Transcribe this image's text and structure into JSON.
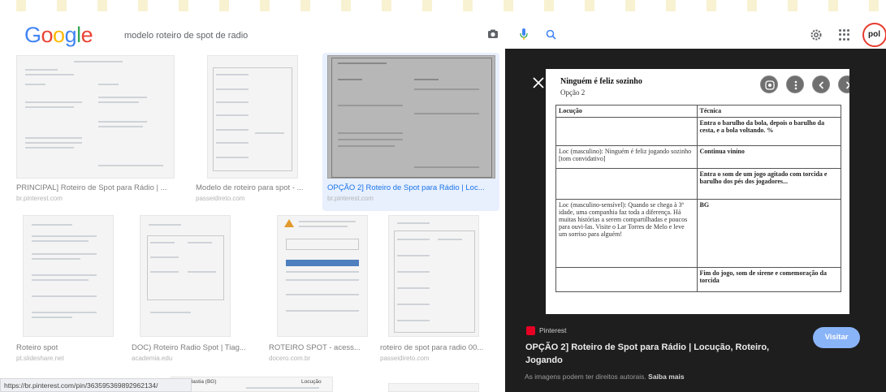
{
  "search": {
    "query": "modelo roteiro de spot de radio"
  },
  "header": {
    "logo": {
      "letters": [
        {
          "ch": "G",
          "color": "#4285f4"
        },
        {
          "ch": "o",
          "color": "#ea4335"
        },
        {
          "ch": "o",
          "color": "#fbbc05"
        },
        {
          "ch": "g",
          "color": "#4285f4"
        },
        {
          "ch": "l",
          "color": "#34a853"
        },
        {
          "ch": "e",
          "color": "#ea4335"
        }
      ]
    },
    "avatar_text": "pol",
    "icons": [
      "camera-icon",
      "mic-icon",
      "search-icon",
      "settings-icon",
      "apps-icon"
    ]
  },
  "results": [
    {
      "title": "PRINCIPAL] Roteiro de Spot para Rádio | ...",
      "source": "br.pinterest.com"
    },
    {
      "title": "Modelo de roteiro para spot - ...",
      "source": "passeidireto.com"
    },
    {
      "title": "OPÇÃO 2] Roteiro de Spot para Rádio | Loc...",
      "source": "br.pinterest.com",
      "selected": true
    },
    {
      "title": "Roteiro spot",
      "source": "pt.slideshare.net"
    },
    {
      "title": "DOC) Roteiro Radio Spot | Tiag...",
      "source": "academia.edu"
    },
    {
      "title": "ROTEIRO SPOT - acess...",
      "source": "docero.com.br"
    },
    {
      "title": "roteiro de spot para radio 00...",
      "source": "passeidireto.com"
    }
  ],
  "status_bar": {
    "url": "https://br.pinterest.com/pin/363595369892962134/"
  },
  "partial_thumb": {
    "left_label": "Sonoplastia (BG)",
    "right_label": "Locução"
  },
  "preview": {
    "doc": {
      "title": "Ninguém é feliz sozinho",
      "subtitle": "Opção 2",
      "headers": [
        "Locução",
        "Técnica"
      ],
      "rows": [
        {
          "loc": "",
          "tech": "Entra o barulho da bola, depois o barulho da cesta, e a bola voltando. %"
        },
        {
          "loc": "Loc (masculino): Ninguém é feliz jogando sozinho [tom convidativo]",
          "tech": "Continua viníno"
        },
        {
          "loc": "",
          "tech": "Entra o som de um jogo agitado com torcida e barulho dos pés dos jogadores..."
        },
        {
          "loc": "Loc (masculino-sensível): Quando se chega à 3ª idade, uma companhia faz toda a diferença. Há muitas histórias a serem compartilhadas e poucos para ouvi-las. Visite o Lar Torres de Melo e leve um sorriso para alguém!",
          "tech": "BG"
        },
        {
          "loc": "",
          "tech": "Fim do jogo, som de sirene e comemoração da torcida"
        }
      ]
    },
    "source_name": "Pinterest",
    "title": "OPÇÃO 2] Roteiro de Spot para Rádio | Locução, Roteiro, Jogando",
    "visit_label": "Visitar",
    "copyright_text": "As imagens podem ter direitos autorais.",
    "learn_more": "Saiba mais"
  }
}
